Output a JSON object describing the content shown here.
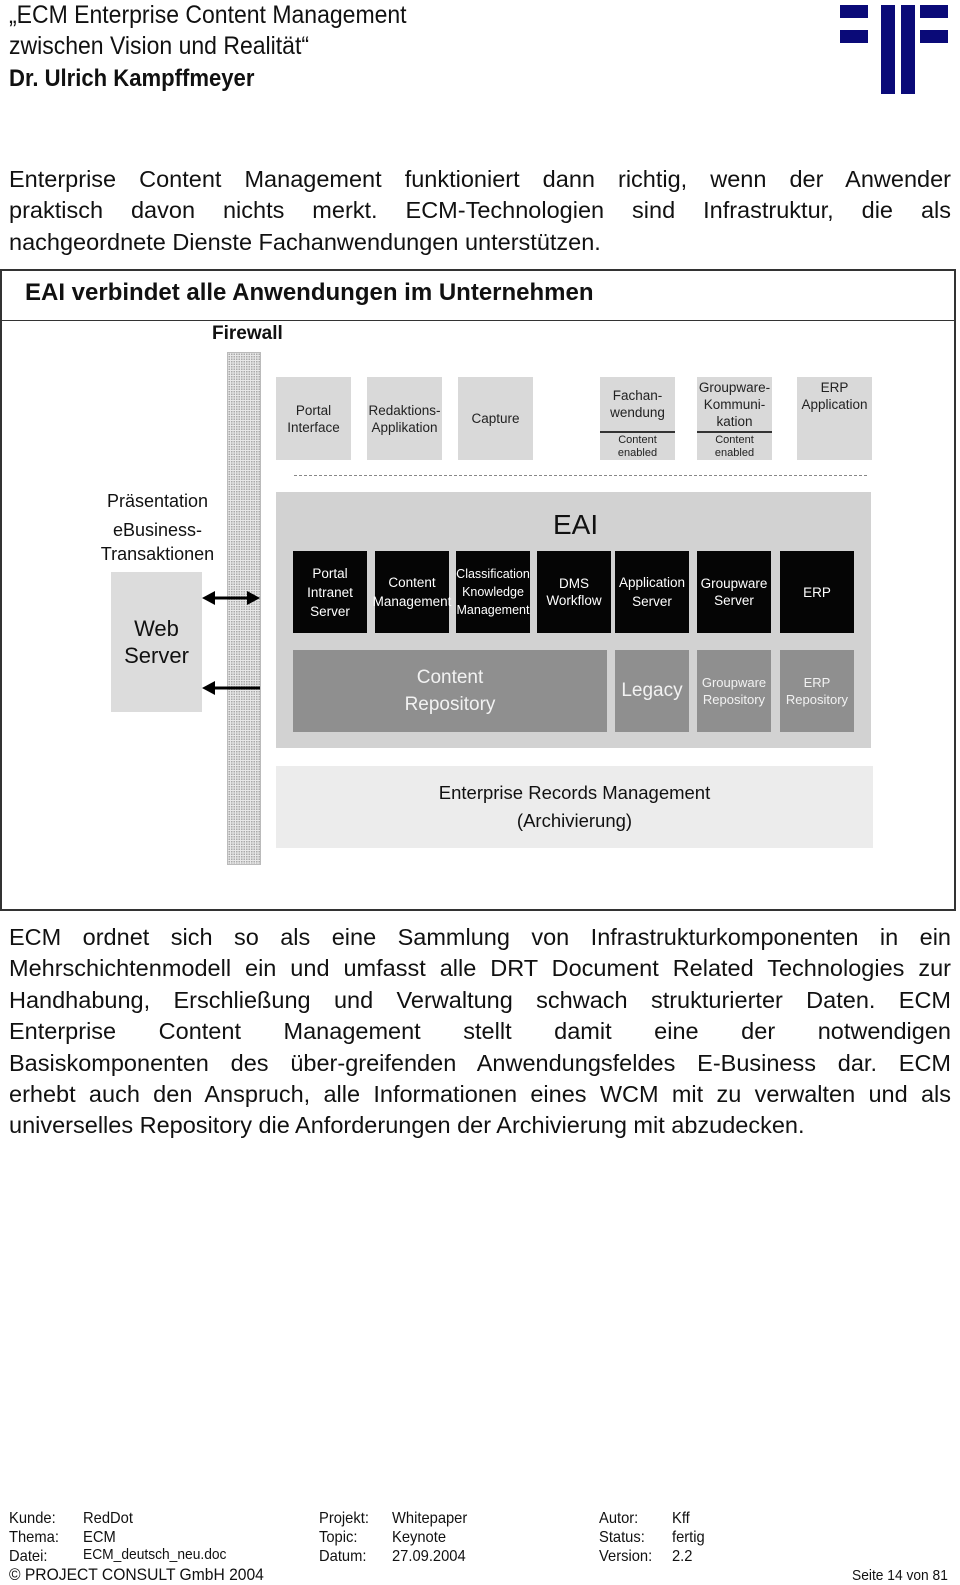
{
  "header": {
    "title_line1": "„ECM Enterprise Content Management",
    "title_line2": "zwischen Vision und Realität“",
    "author": "Dr. Ulrich Kampffmeyer",
    "logo_icon": "project-consult-logo",
    "logo_color": "#0a0a78"
  },
  "intro_paragraph": {
    "lines": [
      "Enterprise Content Management funktioniert dann richtig, wenn der Anwender",
      "praktisch davon nichts merkt. ECM-Technologien sind Infrastruktur, die als",
      "nachgeordnete Dienste Fachanwendungen unterstützen."
    ]
  },
  "diagram": {
    "title": "EAI verbindet alle Anwendungen im Unternehmen",
    "firewall_label": "Firewall",
    "left_labels": {
      "presentation": "Präsentation",
      "ebusiness_line1": "eBusiness-",
      "ebusiness_line2": "Transaktionen",
      "web_server_line1": "Web",
      "web_server_line2": "Server"
    },
    "applications": [
      {
        "lines": [
          "Portal",
          "Interface"
        ]
      },
      {
        "lines": [
          "Redaktions-",
          "Applikation"
        ]
      },
      {
        "lines": [
          "Capture"
        ]
      },
      {
        "lines": [
          "Fachan-",
          "wendung"
        ],
        "sub": [
          "Content",
          "enabled"
        ]
      },
      {
        "lines": [
          "Groupware-",
          "Kommuni-",
          "kation"
        ],
        "sub": [
          "Content",
          "enabled"
        ]
      },
      {
        "lines": [
          "ERP",
          "Application"
        ]
      }
    ],
    "eai_label": "EAI",
    "servers": [
      {
        "lines": [
          "Portal",
          "Intranet",
          "Server"
        ]
      },
      {
        "lines": [
          "Content",
          "Management"
        ]
      },
      {
        "lines": [
          "Classification",
          "Knowledge",
          "Management"
        ]
      },
      {
        "lines": [
          "DMS",
          "Workflow"
        ]
      },
      {
        "lines": [
          "Application",
          "Server"
        ]
      },
      {
        "lines": [
          "Groupware",
          "Server"
        ]
      },
      {
        "lines": [
          "ERP"
        ]
      }
    ],
    "repositories": [
      {
        "lines": [
          "Content",
          "Repository"
        ]
      },
      {
        "lines": [
          "Legacy"
        ]
      },
      {
        "lines": [
          "Groupware",
          "Repository"
        ]
      },
      {
        "lines": [
          "ERP",
          "Repository"
        ]
      }
    ],
    "erm_line1": "Enterprise Records Management",
    "erm_line2": "(Archivierung)",
    "colors": {
      "app_box": "#d9d9d9",
      "eai_container": "#d2d2d2",
      "server_box": "#050505",
      "repository_box": "#8f8f8f",
      "erm_box": "#ececec"
    }
  },
  "body_paragraph": {
    "lines": [
      "ECM ordnet sich so als eine Sammlung von Infrastrukturkomponenten in ein",
      "Mehrschichtenmodell ein und umfasst alle DRT Document Related Technologies zur",
      "Handhabung, Erschließung und Verwaltung schwach strukturierter Daten. ECM",
      "Enterprise Content Management stellt damit eine der notwendigen",
      "Basiskomponenten des über-greifenden Anwendungsfeldes E-Business dar. ECM",
      "erhebt auch den Anspruch, alle Informationen eines WCM mit zu verwalten und als",
      "universelles Repository die Anforderungen der Archivierung mit abzudecken."
    ]
  },
  "footer": {
    "kunde_label": "Kunde:",
    "kunde_value": "RedDot",
    "thema_label": "Thema:",
    "thema_value": "ECM",
    "datei_label": "Datei:",
    "datei_value": "ECM_deutsch_neu.doc",
    "projekt_label": "Projekt:",
    "projekt_value": "Whitepaper",
    "topic_label": "Topic:",
    "topic_value": "Keynote",
    "datum_label": "Datum:",
    "datum_value": "27.09.2004",
    "autor_label": "Autor:",
    "autor_value": "Kff",
    "status_label": "Status:",
    "status_value": "fertig",
    "version_label": "Version:",
    "version_value": "2.2",
    "copyright": "© PROJECT CONSULT GmbH 2004",
    "page": "Seite 14 von 81"
  }
}
